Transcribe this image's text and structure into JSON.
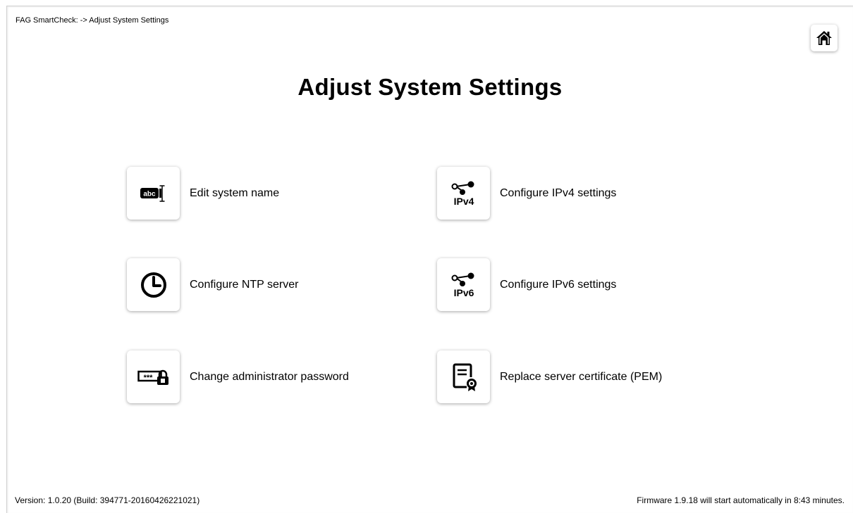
{
  "header": {
    "breadcrumb": "FAG SmartCheck: -> Adjust System Settings",
    "home_icon": "home-icon"
  },
  "page": {
    "title": "Adjust System Settings"
  },
  "items": [
    {
      "label": "Edit system name",
      "icon": "text-edit-icon"
    },
    {
      "label": "Configure IPv4 settings",
      "icon": "ipv4-network-icon",
      "icon_text": "IPv4"
    },
    {
      "label": "Configure NTP server",
      "icon": "clock-icon"
    },
    {
      "label": "Configure IPv6 settings",
      "icon": "ipv6-network-icon",
      "icon_text": "IPv6"
    },
    {
      "label": "Change administrator password",
      "icon": "password-lock-icon"
    },
    {
      "label": "Replace server certificate (PEM)",
      "icon": "certificate-icon"
    }
  ],
  "footer": {
    "version": "Version: 1.0.20 (Build: 394771-20160426221021)",
    "firmware_notice": "Firmware 1.9.18 will start automatically in 8:43 minutes."
  }
}
